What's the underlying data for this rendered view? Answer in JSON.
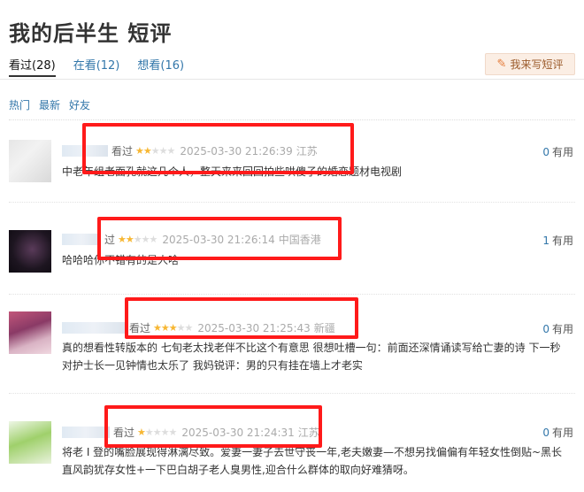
{
  "page": {
    "title": "我的后半生 短评"
  },
  "tabs": [
    {
      "label": "看过(28)",
      "active": true
    },
    {
      "label": "在看(12)",
      "active": false
    },
    {
      "label": "想看(16)",
      "active": false
    }
  ],
  "write_button": {
    "label": "我来写短评",
    "icon": "pencil-icon"
  },
  "subtabs": [
    "热门",
    "最新",
    "好友"
  ],
  "comments": [
    {
      "status": "看过",
      "rating": 2,
      "time": "2025-03-30 21:26:39",
      "location": "江苏",
      "votes": "0",
      "useful_label": "有用",
      "text": "中老年组老面孔就这几个人，整天来来回回拍些哄傻子的婚恋题材电视剧"
    },
    {
      "status": "过",
      "rating": 2,
      "time": "2025-03-30 21:26:14",
      "location": "中国香港",
      "votes": "1",
      "useful_label": "有用",
      "text": "哈哈哈你不错有的是人啥"
    },
    {
      "status": "看过",
      "rating": 3,
      "time": "2025-03-30 21:25:43",
      "location": "新疆",
      "votes": "0",
      "useful_label": "有用",
      "text": "真的想看性转版本的 七旬老太找老伴不比这个有意思 很想吐槽一句：前面还深情诵读写给亡妻的诗 下一秒对护士长一见钟情也太乐了 我妈锐评：男的只有挂在墙上才老实"
    },
    {
      "status": "看过",
      "rating": 1,
      "time": "2025-03-30 21:24:31",
      "location": "江苏",
      "votes": "0",
      "useful_label": "有用",
      "text": "将老 I 登的嘴脸展现得淋漓尽致。爱妻一妻子去世守丧一年,老夫嫩妻—不想另找偏偏有年轻女性倒贴~黑长直风韵犹存女性+一下巴白胡子老人臭男性,迎合什么群体的取向好难猜呀。"
    }
  ]
}
